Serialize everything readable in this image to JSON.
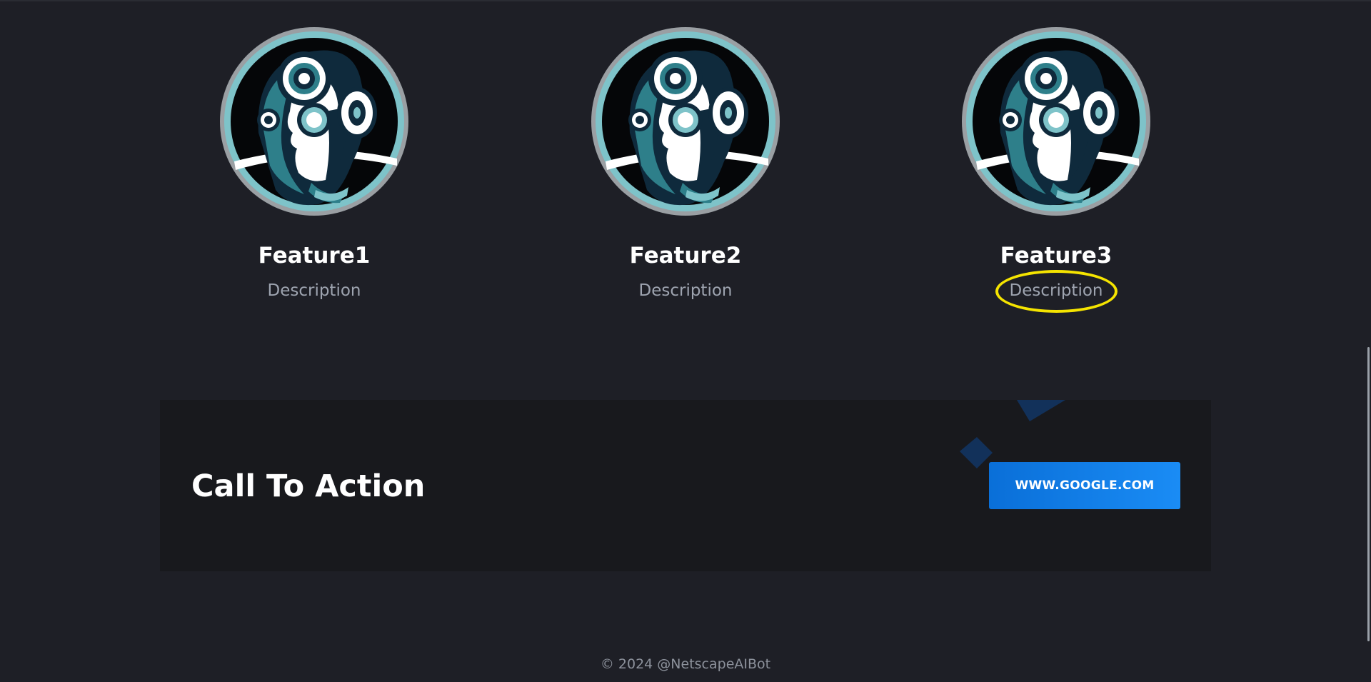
{
  "features": [
    {
      "title": "Feature1",
      "description": "Description",
      "icon": "robot-head-icon"
    },
    {
      "title": "Feature2",
      "description": "Description",
      "icon": "robot-head-icon"
    },
    {
      "title": "Feature3",
      "description": "Description",
      "icon": "robot-head-icon"
    }
  ],
  "cta": {
    "title": "Call To Action",
    "button_label": "WWW.GOOGLE.COM"
  },
  "footer": {
    "copyright": "© 2024 @NetscapeAIBot"
  },
  "colors": {
    "background": "#1e1f26",
    "cta_background": "#18191d",
    "button": "#1a8cf5",
    "highlight": "#f5e400"
  }
}
